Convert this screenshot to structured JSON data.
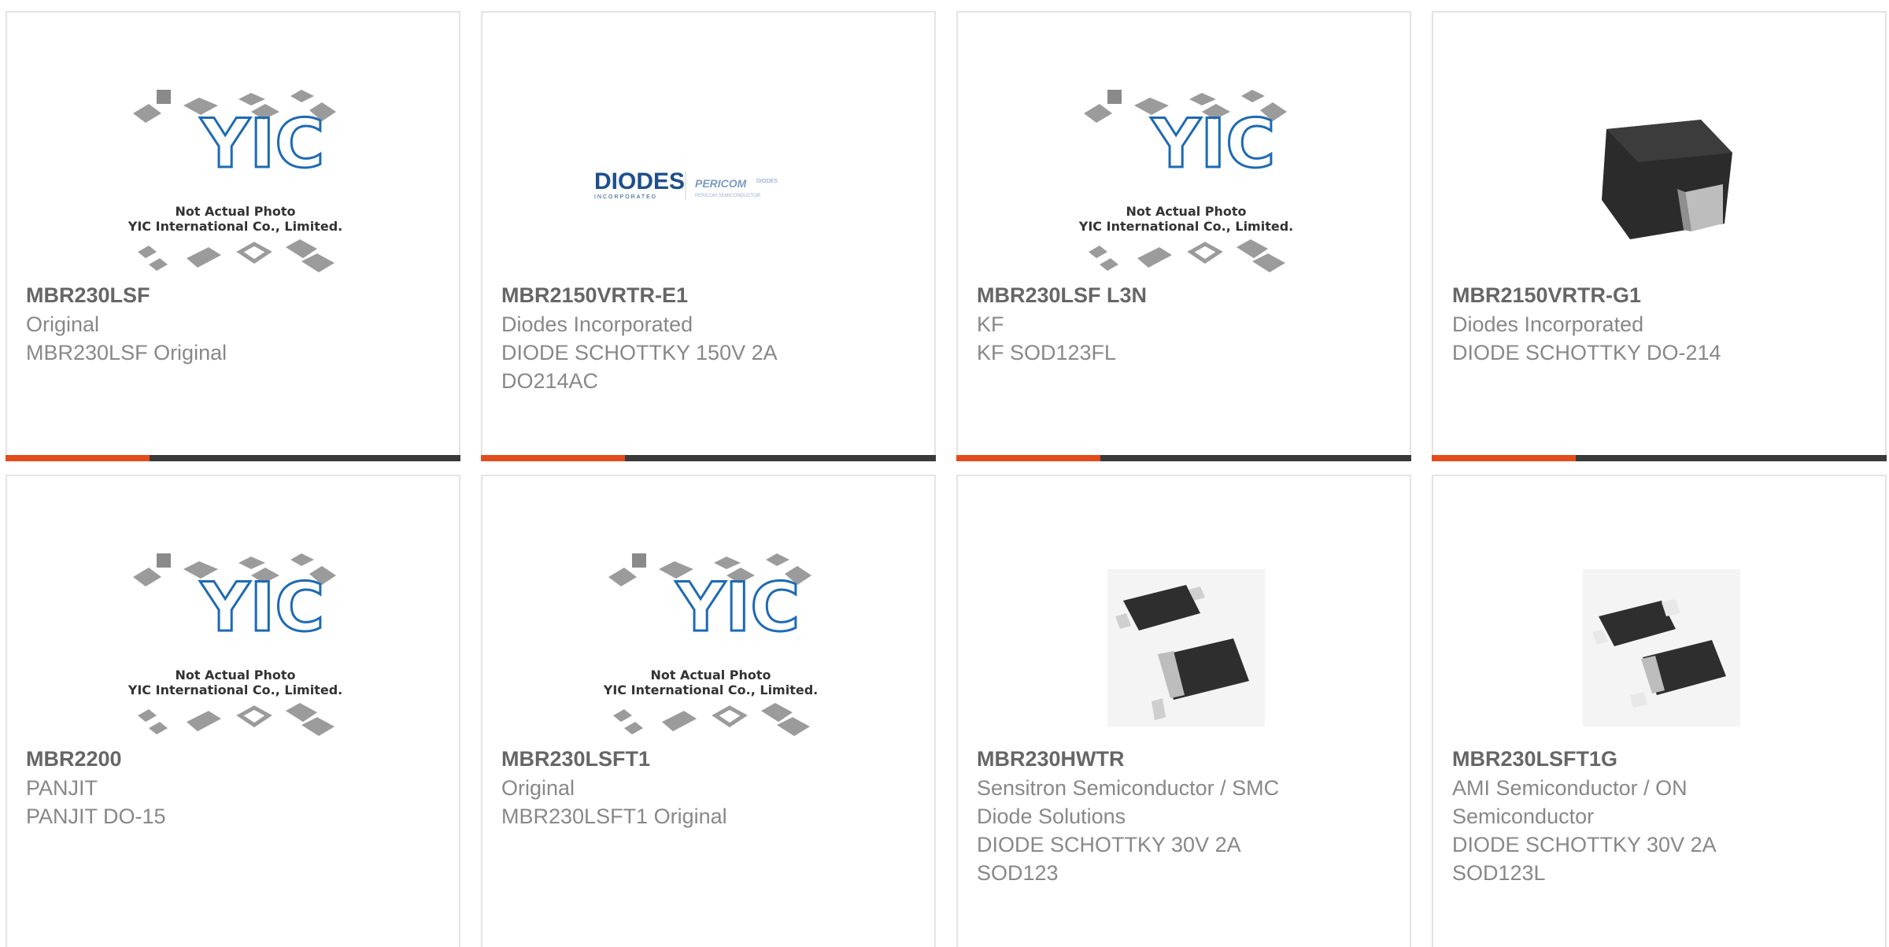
{
  "products": [
    {
      "pn": "MBR230LSF",
      "lines": [
        "Original",
        "MBR230LSF Original"
      ],
      "image": "yic-placeholder"
    },
    {
      "pn": "MBR2150VRTR-E1",
      "lines": [
        "Diodes Incorporated",
        "DIODE SCHOTTKY 150V 2A",
        "DO214AC"
      ],
      "image": "diodes-logo"
    },
    {
      "pn": "MBR230LSF L3N",
      "lines": [
        "KF",
        "KF SOD123FL"
      ],
      "image": "yic-placeholder"
    },
    {
      "pn": "MBR2150VRTR-G1",
      "lines": [
        "Diodes Incorporated",
        "DIODE SCHOTTKY DO-214"
      ],
      "image": "smd-diode"
    },
    {
      "pn": "MBR2200",
      "lines": [
        "PANJIT",
        "PANJIT DO-15"
      ],
      "image": "yic-placeholder"
    },
    {
      "pn": "MBR230LSFT1",
      "lines": [
        "Original",
        "MBR230LSFT1 Original"
      ],
      "image": "yic-placeholder"
    },
    {
      "pn": "MBR230HWTR",
      "lines": [
        "Sensitron Semiconductor / SMC",
        "Diode Solutions",
        "DIODE SCHOTTKY 30V 2A",
        "SOD123"
      ],
      "image": "sod123-pair"
    },
    {
      "pn": "MBR230LSFT1G",
      "lines": [
        "AMI Semiconductor / ON",
        "Semiconductor",
        "DIODE SCHOTTKY 30V 2A",
        "SOD123L"
      ],
      "image": "sod123-pair"
    }
  ],
  "placeholder": {
    "brand": "YIC",
    "caption1": "Not Actual Photo",
    "caption2": "YIC International Co., Limited."
  },
  "diodes_logo": {
    "word": "DIODES",
    "sub": "INCORPORATED",
    "pericom": "PERICOM",
    "pericom_sub": "DIODES",
    "pericom_tag": "PERICOM SEMICONDUCTOR"
  },
  "colors": {
    "accent": "#e34d1d",
    "bar": "#3a3a3a",
    "brand_blue": "#1d6ab3"
  }
}
